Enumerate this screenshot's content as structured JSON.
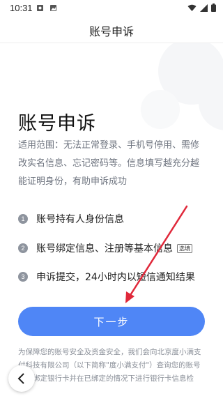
{
  "status_bar": {
    "time": "10:31",
    "left_icons": [
      "photo-notification-icon",
      "image-notification-icon"
    ],
    "right_icons": [
      "wifi-icon",
      "signal-icon",
      "battery-icon"
    ]
  },
  "nav": {
    "title": "账号申诉"
  },
  "page": {
    "heading": "账号申诉",
    "description": "适用范围：无法正常登录、手机号停用、需修改实名信息、忘记密码等。信息填写越充分越能证明身份，有助申诉成功"
  },
  "steps": [
    {
      "number": "1",
      "text": "账号持有人身份信息"
    },
    {
      "number": "2",
      "text": "账号绑定信息、注册等基本信息",
      "tag": "选填"
    },
    {
      "number": "3",
      "text": "申诉提交，24小时内以短信通知结果"
    }
  ],
  "actions": {
    "next_label": "下一步"
  },
  "footer": {
    "notice": "为保障您的账号安全及资金安全，我们会向北京度小满支付科技有限公司（以下简称\"度小满支付\"）查询您的账号是否绑定银行卡并在已绑定的情况下进行银行卡信息检"
  },
  "colors": {
    "accent": "#4f86f6",
    "annotation_arrow": "#e0283a",
    "step_badge": "#8e949e",
    "muted_text": "#6f7580"
  }
}
